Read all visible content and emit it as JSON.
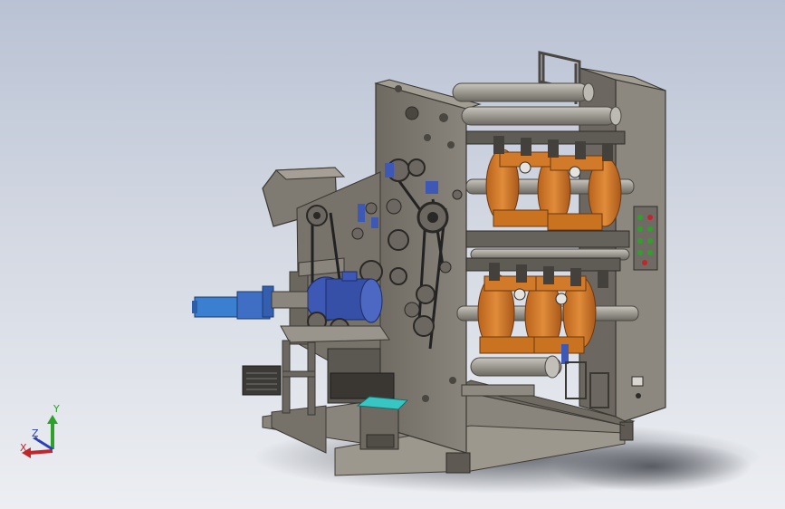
{
  "viewport": {
    "background_top": "#b9c2d4",
    "background_bottom": "#eceef2",
    "model_colors": {
      "frame": "#7d786f",
      "frame_dark": "#4f4b45",
      "frame_light": "#a8a298",
      "roll_orange": "#d07a2a",
      "motor_blue": "#3d59b5",
      "cylinder_blue": "#3b7fd0",
      "teal_block": "#37c6c2",
      "shaft": "#9b9890"
    }
  },
  "triad": {
    "x_label": "X",
    "y_label": "Y",
    "z_label": "Z",
    "x_color": "#c0262a",
    "y_color": "#2fa12a",
    "z_color": "#2a3fb8"
  }
}
